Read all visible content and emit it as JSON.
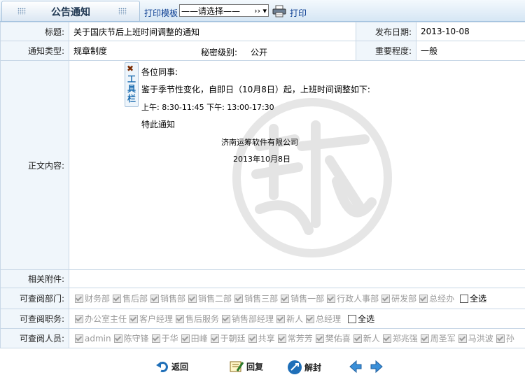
{
  "header": {
    "tab_title": "公告通知",
    "print_template_label": "打印模板",
    "select_value": "——请选择——",
    "print_label": "打印"
  },
  "fields": {
    "title_label": "标题:",
    "title_value": "关于国庆节后上班时间调整的通知",
    "publish_date_label": "发布日期:",
    "publish_date_value": "2013-10-08",
    "notice_type_label": "通知类型:",
    "notice_type_value": "规章制度",
    "secret_level_label": "秘密级别:",
    "secret_level_value": "公开",
    "importance_label": "重要程度:",
    "importance_value": "一般",
    "content_label": "正文内容:",
    "attachments_label": "相关附件:",
    "dept_label": "可查阅部门:",
    "duty_label": "可查阅职务:",
    "person_label": "可查阅人员:"
  },
  "toolbox": {
    "chars": [
      "工",
      "具",
      "栏"
    ]
  },
  "content": {
    "line1": "各位同事:",
    "line2": "鉴于季节性变化，自即日（10月8日）起，上班时间调整如下:",
    "line3": "上午: 8:30-11:45   下午: 13:00-17:30",
    "line4": "特此通知",
    "company": "济南运筹软件有限公司",
    "date": "2013年10月8日"
  },
  "departments": [
    "财务部",
    "售后部",
    "销售部",
    "销售二部",
    "销售三部",
    "销售一部",
    "行政人事部",
    "研发部",
    "总经办"
  ],
  "duties": [
    "办公室主任",
    "客户经理",
    "售后服务",
    "销售部经理",
    "新人",
    "总经理"
  ],
  "persons": [
    "admin",
    "陈守锋",
    "于华",
    "田峰",
    "于朝廷",
    "共享",
    "常芳芳",
    "樊佑喜",
    "新人",
    "郑兆强",
    "周圣军",
    "马洪波",
    "孙"
  ],
  "select_all_label": "全选",
  "footer": {
    "back_label": "返回",
    "reply_label": "回复",
    "unseal_label": "解封"
  },
  "colors": {
    "link": "#0a3d91",
    "label_bg": "#f0f6fb",
    "border": "#c8d7e6"
  }
}
